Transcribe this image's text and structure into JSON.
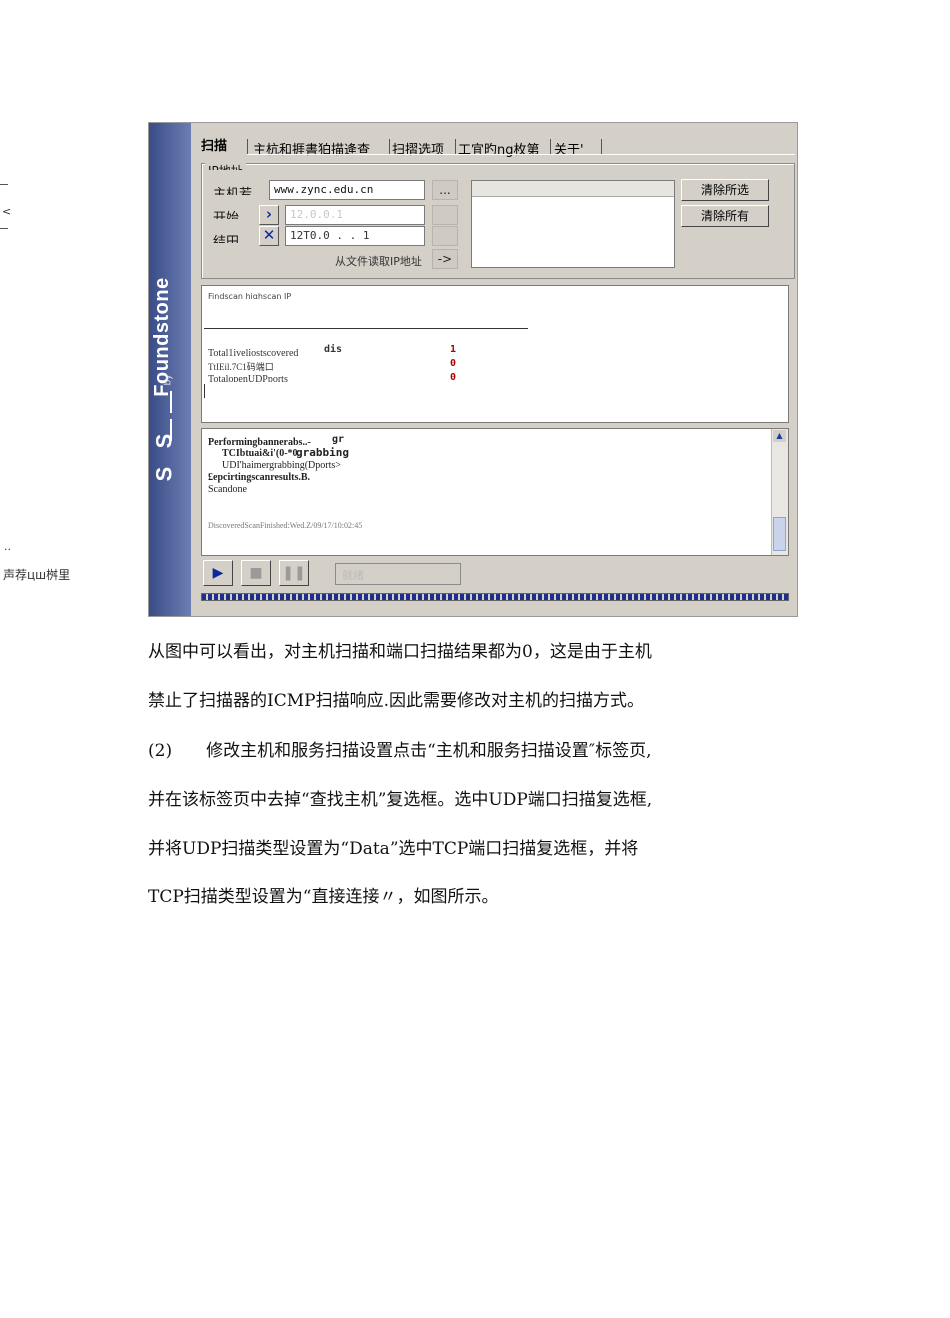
{
  "margin": {
    "mark_top": "<",
    "mark_dots": "..",
    "side_text": "声荐цш桝里"
  },
  "screenshot": {
    "brand": {
      "word": "Foundstone",
      "by": "by",
      "logo": "Su S S"
    },
    "tabs": [
      "扫描",
      "主杭和捱書狛描逄查",
      "扫摺选项",
      "工宜旳ng枚第",
      "关于'"
    ],
    "group_legend": "IP地址",
    "host_label": "主机若",
    "host_value": "www.zync.edu.cn",
    "start_label": "开始",
    "start_value": "12.0.0.1",
    "end_label": "结田",
    "end_value": "12T0.0 . . 1",
    "range_label": "从文件读取IP地址",
    "arrow_button": "->",
    "add_button": "...",
    "clear_selected": "清除所选",
    "clear_all": "清除所有",
    "output_header": "Findscan highscan IP",
    "stats": {
      "hosts_label": "Total1iveliostscovered",
      "hosts_word": "dis",
      "hosts_value": "1",
      "tcp_label": "TtIEil.7C1码端口",
      "tcp_value": "0",
      "udp_label": "TotalopenUDPports",
      "udp_value": "0"
    },
    "log_lines": [
      "Performingbannerabs..-",
      "TCIbtuai&i'(0-*0",
      "UDI'haimergrabbing(Dports>",
      "£epcirtingscanresults.B.",
      "Scandone"
    ],
    "log_gr": "gr",
    "log_grabbing": "grabbing",
    "log_footer": "DiscoveredScanFinished:Wed.Z/09/17/10:02:45",
    "status_box": "就绪"
  },
  "paragraphs": [
    "从图中可以看出，对主机扫描和端口扫描结果都为0，这是由于主机",
    "禁止了扫描器的ICMP扫描响应.因此需要修改对主机的扫描方式。",
    "(2)　　修改主机和服务扫描设置点击“主机和服务扫描设置″标签页,",
    "并在该标签页中去掉“查找主机”复选框。选中UDP端口扫描复选框,",
    "并将UDP扫描类型设置为“Data”选中TCP端口扫描复选框，并将",
    "TCP扫描类型设置为“直接连接〃，如图所示。"
  ]
}
